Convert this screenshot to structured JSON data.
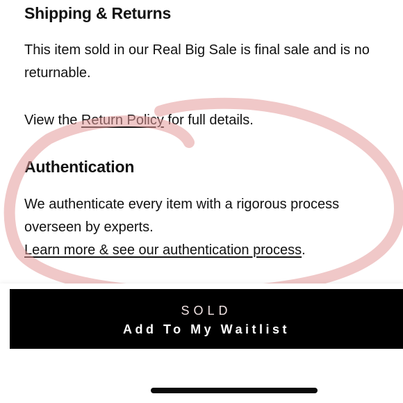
{
  "shipping": {
    "heading": "Shipping & Returns",
    "text_line1": "This item sold in our Real Big Sale is final sale and is no",
    "text_line2": "returnable.",
    "policy_prefix": "View the ",
    "policy_link": "Return Policy",
    "policy_suffix": " for full details."
  },
  "authentication": {
    "heading": "Authentication",
    "text_line1": "We authenticate every item with a rigorous process",
    "text_line2": "overseen by experts.",
    "learn_more_link": "Learn more & see our authentication process",
    "learn_more_suffix": "."
  },
  "cta": {
    "status": "SOLD",
    "label": "Add To My Waitlist"
  },
  "colors": {
    "annotation": "#e39a9a",
    "button_bg": "#000000",
    "button_text": "#ffffff"
  }
}
